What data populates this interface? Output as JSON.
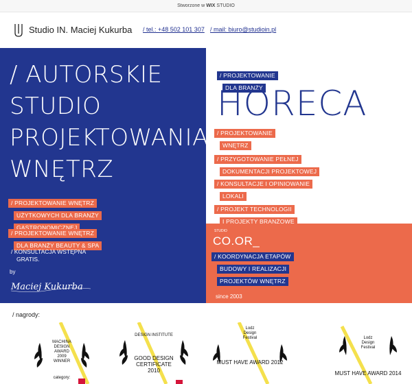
{
  "wix_banner": {
    "prefix": "Stworzone w",
    "brand": "WIX",
    "suffix": "STUDIO"
  },
  "header": {
    "brand": "Studio IN. Maciej Kukurba",
    "phone": "/ tel.: +48 502 101 307",
    "email": "/ mail: biuro@studioin.pl"
  },
  "hero_left": {
    "title_lines": [
      "/ AUTORSKIE",
      "STUDIO",
      "PROJEKTOWANIA",
      "WNĘTRZ"
    ],
    "tag1_lines": [
      "/ PROJEKTOWANIE WNĘTRZ",
      "UŻYTKOWYCH DLA BRANŻY",
      "GASTRONOMICZNEJ"
    ],
    "tag2_lines": [
      "/ PROJEKTOWANIE WNĘTRZ",
      "DLA BRANŻY BEAUTY & SPA"
    ],
    "plain_lines": [
      "/ KONSULTACJA WSTĘPNA",
      "GRATIS."
    ],
    "by": "by",
    "signature": "Maciej Kukurba"
  },
  "hero_right": {
    "pre_tag_lines": [
      "/ PROJEKTOWANIE",
      "DLA BRANŻY"
    ],
    "headline": "HORECA",
    "services": [
      [
        "/ PROJEKTOWANIE",
        "WNĘTRZ"
      ],
      [
        "/ PRZYGOTOWANIE PEŁNEJ",
        "DOKUMENTACJI PROJEKTOWEJ"
      ],
      [
        "/ KONSULTACJE I OPINIOWANIE",
        "LOKALI"
      ],
      [
        "/ PROJEKT TECHNOLOGII",
        "I PROJEKTY BRANŻOWE"
      ]
    ],
    "coor_small": "STUDIO",
    "coor": "CO.OR_",
    "coor_tag_lines": [
      "/ KOORDYNACJA ETAPÓW",
      "BUDOWY I REALIZACJI",
      "PROJEKTÓW WNĘTRZ"
    ],
    "since": "since 2003"
  },
  "awards": {
    "label": "/ nagrody:",
    "items": [
      {
        "top": [
          "MACHINA",
          "DESIGN",
          "AWARD",
          "2009",
          "WINNER"
        ],
        "sub": "category:"
      },
      {
        "top": [
          "DESIGN INSTITUTE"
        ],
        "main": [
          "GOOD DESIGN",
          "CERTIFICATE",
          "2010"
        ]
      },
      {
        "top": [
          "Lodz",
          "Design",
          "Festival"
        ],
        "main": [
          "MUST HAVE AWARD 2012"
        ]
      },
      {
        "top": [
          "Lodz",
          "Design",
          "Festival"
        ],
        "main": [
          "MUST HAVE AWARD 2014"
        ]
      }
    ]
  },
  "colors": {
    "blue": "#22368f",
    "orange": "#ec6a4b",
    "yellow": "#f4e04d",
    "red": "#d5153a"
  }
}
